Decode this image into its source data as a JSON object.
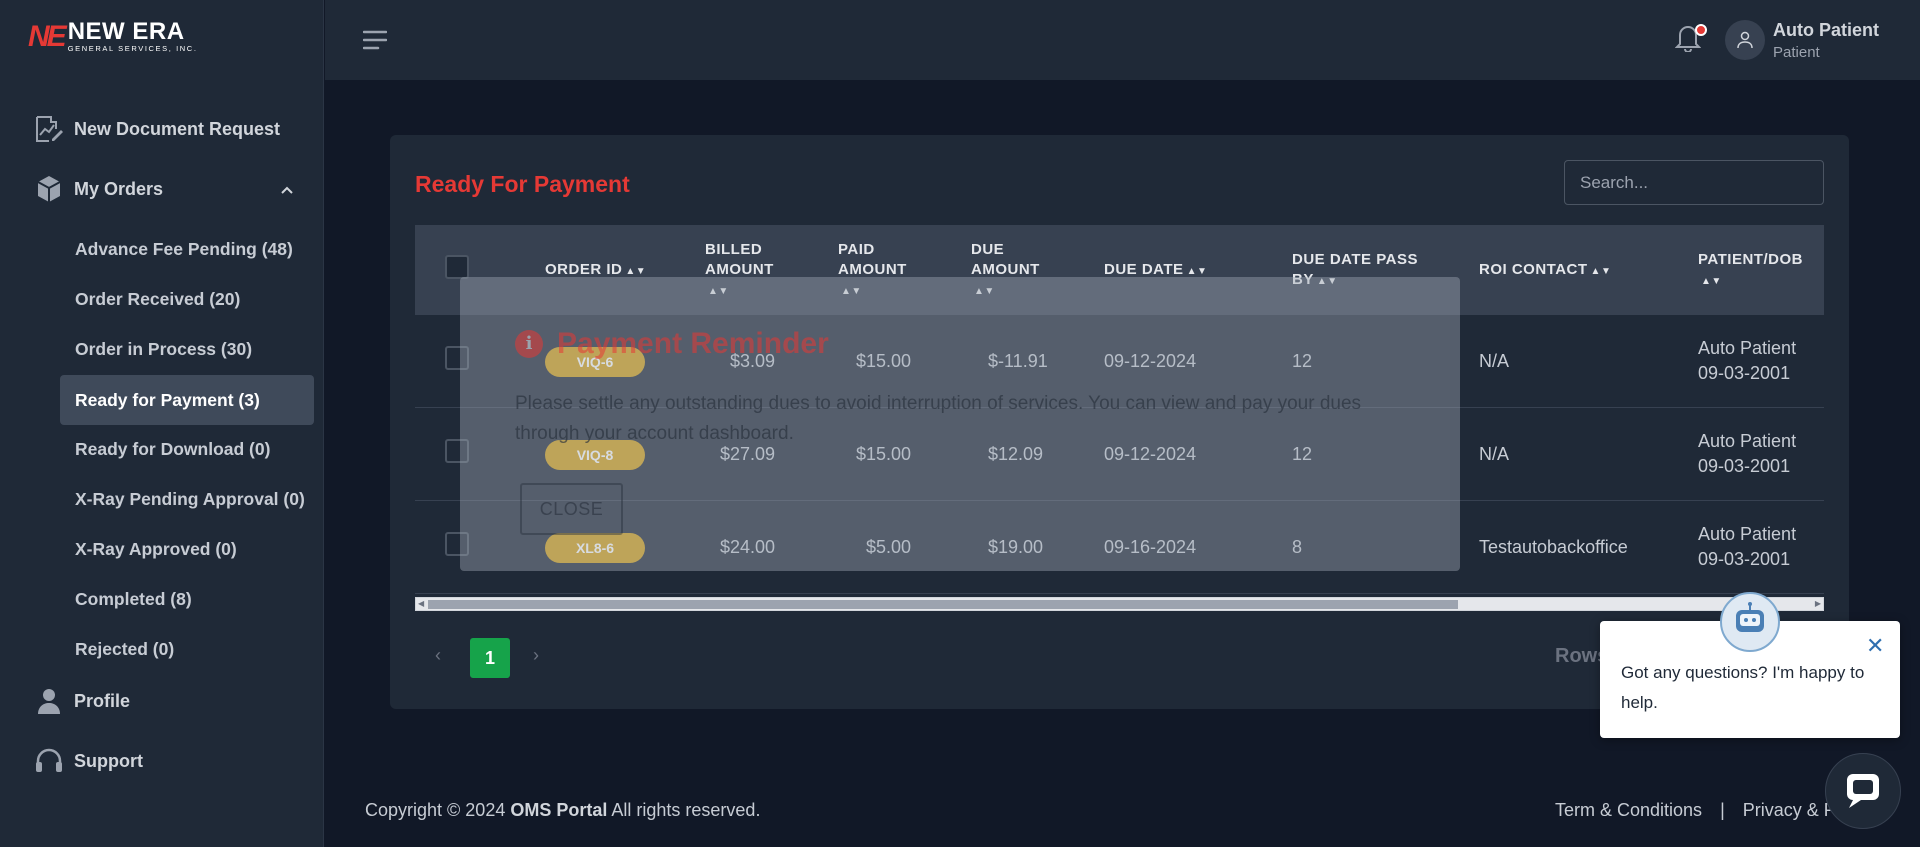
{
  "brand": {
    "mark": "NE",
    "name": "NEW ERA",
    "sub": "GENERAL SERVICES, INC."
  },
  "sidebar": {
    "new_request": "New Document Request",
    "my_orders": "My Orders",
    "orders": [
      "Advance Fee Pending (48)",
      "Order Received (20)",
      "Order in Process (30)",
      "Ready for Payment (3)",
      "Ready for Download (0)",
      "X-Ray Pending Approval (0)",
      "X-Ray Approved (0)",
      "Completed (8)",
      "Rejected (0)"
    ],
    "profile": "Profile",
    "support": "Support"
  },
  "header": {
    "user_name": "Auto Patient",
    "user_role": "Patient"
  },
  "main": {
    "title": "Ready For Payment",
    "search_placeholder": "Search...",
    "columns": {
      "order_id": "ORDER ID",
      "billed_1": "BILLED",
      "billed_2": "AMOUNT",
      "paid_1": "PAID",
      "paid_2": "AMOUNT",
      "due_1": "DUE",
      "due_2": "AMOUNT",
      "due_date": "DUE DATE",
      "pass_1": "DUE DATE PASS",
      "pass_2": "BY",
      "roi": "ROI CONTACT",
      "patient": "PATIENT/DOB"
    },
    "rows": [
      {
        "id": "VIQ-6",
        "billed": "$3.09",
        "paid": "$15.00",
        "due": "$-11.91",
        "due_date": "09-12-2024",
        "pass": "12",
        "roi": "N/A",
        "patient": "Auto Patient",
        "dob": "09-03-2001"
      },
      {
        "id": "VIQ-8",
        "billed": "$27.09",
        "paid": "$15.00",
        "due": "$12.09",
        "due_date": "09-12-2024",
        "pass": "12",
        "roi": "N/A",
        "patient": "Auto Patient",
        "dob": "09-03-2001"
      },
      {
        "id": "XL8-6",
        "billed": "$24.00",
        "paid": "$5.00",
        "due": "$19.00",
        "due_date": "09-16-2024",
        "pass": "8",
        "roi": "Testautobackoffice",
        "patient": "Auto Patient",
        "dob": "09-03-2001"
      }
    ],
    "pagination": {
      "prev": "‹",
      "current": "1",
      "next": "›",
      "rows_label": "Rows"
    }
  },
  "modal": {
    "title": "Payment Reminder",
    "body": "Please settle any outstanding dues to avoid interruption of services. You can view and pay your dues through your account dashboard.",
    "close": "CLOSE"
  },
  "chat": {
    "message": "Got any questions? I'm happy to help."
  },
  "footer": {
    "copyright_prefix": "Copyright © 2024",
    "portal": "OMS Portal",
    "copyright_suffix": "All rights reserved.",
    "terms": "Term & Conditions",
    "privacy": "Privacy & P"
  },
  "colors": {
    "accent_red": "#e53935",
    "badge_gold": "#d4a017",
    "page_green": "#16a34a",
    "sidebar_bg": "#1f2937",
    "page_bg": "#111827"
  }
}
